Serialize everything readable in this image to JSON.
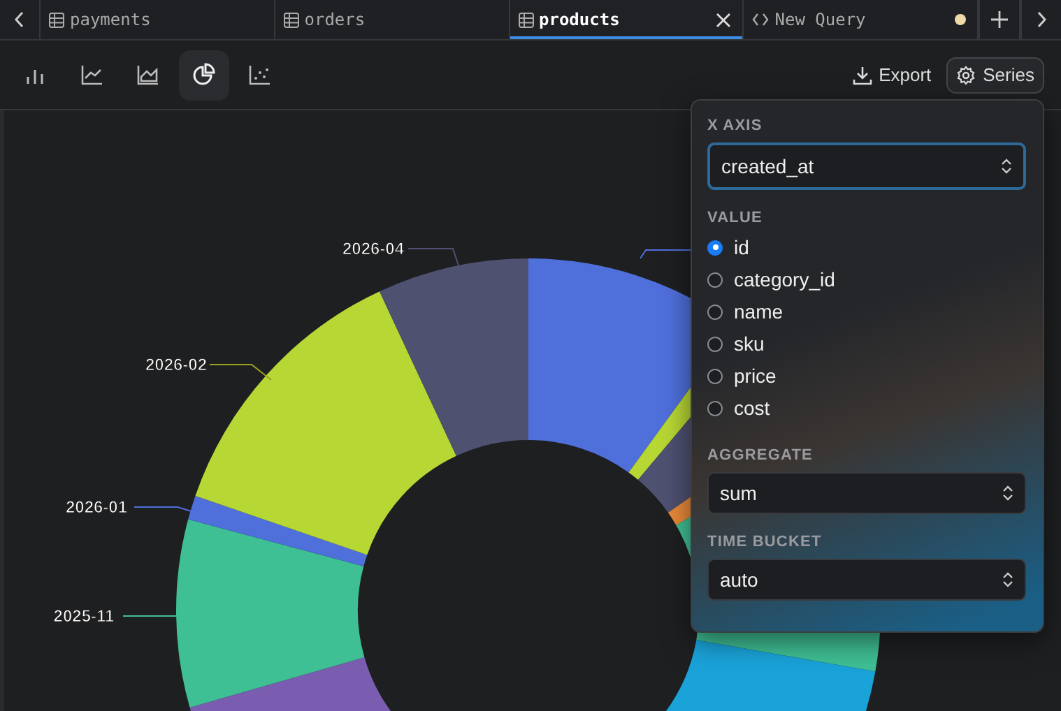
{
  "tabs": [
    {
      "kind": "table",
      "label": "payments",
      "selected": false,
      "modified": false
    },
    {
      "kind": "table",
      "label": "orders",
      "selected": false,
      "modified": false
    },
    {
      "kind": "table",
      "label": "products",
      "selected": true,
      "modified": false
    },
    {
      "kind": "query",
      "label": "New Query",
      "selected": false,
      "modified": true
    }
  ],
  "chart_types": [
    {
      "kind": "bar",
      "selected": false
    },
    {
      "kind": "line",
      "selected": false
    },
    {
      "kind": "area",
      "selected": false
    },
    {
      "kind": "pie",
      "selected": true
    },
    {
      "kind": "scatter",
      "selected": false
    }
  ],
  "actions": [
    {
      "kind": "export",
      "label": "Export"
    },
    {
      "kind": "series",
      "label": "Series"
    }
  ],
  "chart": {
    "slice_labels": [
      "2026-04",
      "2026-02",
      "2026-01",
      "2025-11"
    ]
  },
  "series_panel": {
    "x_axis": {
      "label": "X AXIS",
      "value": "created_at"
    },
    "value": {
      "label": "VALUE",
      "options": [
        {
          "label": "id",
          "selected": true
        },
        {
          "label": "category_id",
          "selected": false
        },
        {
          "label": "name",
          "selected": false
        },
        {
          "label": "sku",
          "selected": false
        },
        {
          "label": "price",
          "selected": false
        },
        {
          "label": "cost",
          "selected": false
        }
      ]
    },
    "aggregate": {
      "label": "AGGREGATE",
      "value": "sum"
    },
    "time_bucket": {
      "label": "TIME BUCKET",
      "value": "auto"
    }
  }
}
